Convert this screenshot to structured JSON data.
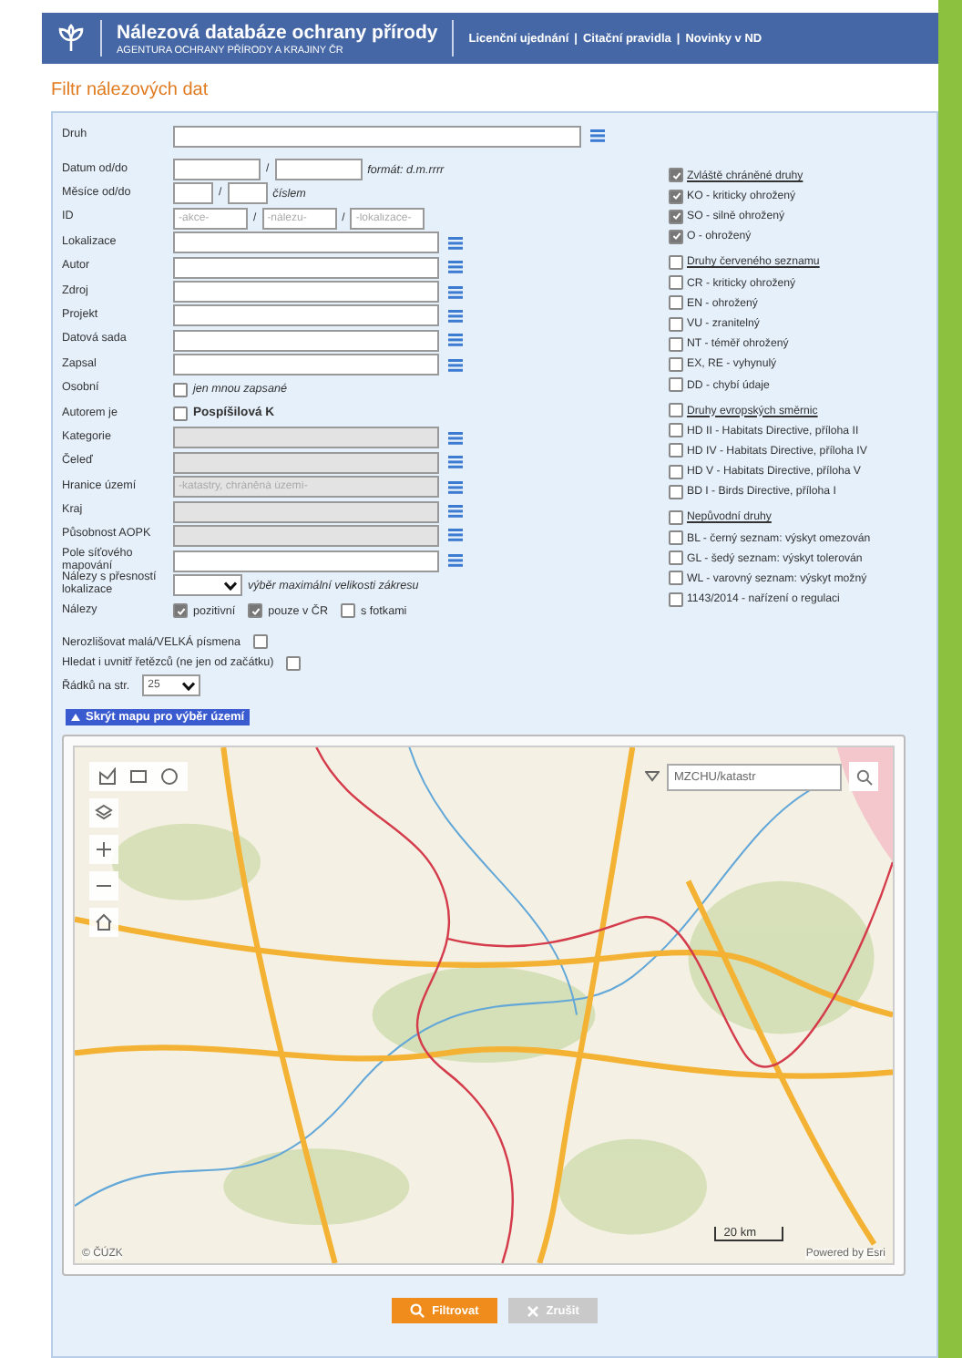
{
  "header": {
    "title": "Nálezová databáze ochrany přírody",
    "subtitle": "AGENTURA OCHRANY PŘÍRODY A KRAJINY ČR",
    "links": [
      "Licenční ujednání",
      "Citační pravidla",
      "Novinky v ND"
    ],
    "separators": [
      "|",
      "|"
    ]
  },
  "page_title": "Filtr nálezových dat",
  "species": {
    "label": "Druh"
  },
  "fields": [
    {
      "kind": "range",
      "label": "Datum od/do",
      "separator": "/",
      "hint": "formát: d.m.rrrr",
      "narrow": false
    },
    {
      "kind": "range",
      "label": "Měsíce od/do",
      "separator": "/",
      "hint": "číslem",
      "narrow": true
    },
    {
      "kind": "id",
      "label": "ID",
      "placeholders": [
        "-akce-",
        "-nálezu-",
        "-lokalizace-"
      ],
      "separators": [
        "/",
        "/"
      ]
    },
    {
      "kind": "text",
      "label": "Lokalizace",
      "disabled": false
    },
    {
      "kind": "text",
      "label": "Autor",
      "disabled": false
    },
    {
      "kind": "text",
      "label": "Zdroj",
      "disabled": false
    },
    {
      "kind": "text",
      "label": "Projekt",
      "disabled": false
    },
    {
      "kind": "text",
      "label": "Datová sada",
      "disabled": false
    },
    {
      "kind": "text",
      "label": "Zapsal",
      "disabled": false
    },
    {
      "kind": "check",
      "label": "Osobní",
      "options": [
        {
          "text": "jen mnou zapsané",
          "checked": false,
          "italic": true
        }
      ]
    },
    {
      "kind": "check",
      "label": "Autorem je",
      "options": [
        {
          "text": "Pospíšilová K",
          "checked": false,
          "bold": true
        }
      ]
    },
    {
      "kind": "text",
      "label": "Kategorie",
      "disabled": true
    },
    {
      "kind": "text",
      "label": "Čeleď",
      "disabled": true
    },
    {
      "kind": "text",
      "label": "Hranice území",
      "disabled": true,
      "placeholder": "-katastry, chráněná území-"
    },
    {
      "kind": "text",
      "label": "Kraj",
      "disabled": true
    },
    {
      "kind": "text",
      "label": "Působnost AOPK",
      "disabled": true
    },
    {
      "kind": "text",
      "label": "Pole síťového mapování",
      "disabled": false
    },
    {
      "kind": "select",
      "label": "Nálezy s přesností lokalizace",
      "hint": "výběr maximální velikosti zákresu"
    },
    {
      "kind": "check",
      "label": "Nálezy",
      "options": [
        {
          "text": "pozitivní",
          "checked": true
        },
        {
          "text": "pouze v ČR",
          "checked": true
        },
        {
          "text": "s fotkami",
          "checked": false
        }
      ]
    }
  ],
  "options": [
    {
      "label": "Nerozlišovat malá/VELKÁ písmena",
      "checked": false
    },
    {
      "label": "Hledat i uvnitř řetězců (ne jen od začátku)",
      "checked": false
    }
  ],
  "rows_per_page": {
    "label": "Řádků na str.",
    "value": "25"
  },
  "groups": [
    {
      "title": "Zvláště chráněné druhy",
      "checked": true,
      "items": [
        {
          "label": "KO - kriticky ohrožený",
          "checked": true
        },
        {
          "label": "SO - silně ohrožený",
          "checked": true
        },
        {
          "label": "O - ohrožený",
          "checked": true
        }
      ]
    },
    {
      "title": "Druhy červeného seznamu",
      "checked": false,
      "items": [
        {
          "label": "CR - kriticky ohrožený",
          "checked": false
        },
        {
          "label": "EN - ohrožený",
          "checked": false
        },
        {
          "label": "VU - zranitelný",
          "checked": false
        },
        {
          "label": "NT - téměř ohrožený",
          "checked": false
        },
        {
          "label": "EX, RE - vyhynulý",
          "checked": false
        },
        {
          "label": "DD - chybí údaje",
          "checked": false
        }
      ]
    },
    {
      "title": "Druhy evropských směrnic",
      "checked": false,
      "items": [
        {
          "label": "HD II - Habitats Directive, příloha II",
          "checked": false
        },
        {
          "label": "HD IV - Habitats Directive, příloha IV",
          "checked": false
        },
        {
          "label": "HD V - Habitats Directive, příloha V",
          "checked": false
        },
        {
          "label": "BD I - Birds Directive, příloha I",
          "checked": false
        }
      ]
    },
    {
      "title": "Nepůvodní druhy",
      "checked": false,
      "items": [
        {
          "label": "BL - černý seznam: výskyt omezován",
          "checked": false
        },
        {
          "label": "GL - šedý seznam: výskyt tolerován",
          "checked": false
        },
        {
          "label": "WL - varovný seznam: výskyt možný",
          "checked": false
        },
        {
          "label": "1143/2014 - nařízení o regulaci",
          "checked": false
        }
      ]
    }
  ],
  "map_toggle": {
    "label": "Skrýt mapu pro výběr území",
    "expanded": true
  },
  "map": {
    "search_placeholder": "MZCHU/katastr",
    "scale": "20 km",
    "copyright": "© ČÚZK",
    "powered": "Powered by Esri"
  },
  "buttons": [
    {
      "kind": "primary",
      "label": "Filtrovat"
    },
    {
      "kind": "secondary",
      "label": "Zrušit"
    }
  ]
}
